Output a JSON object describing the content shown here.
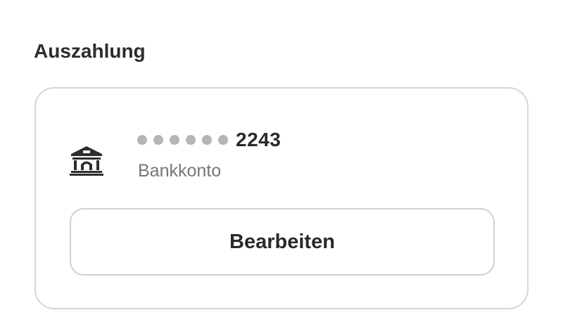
{
  "payout": {
    "title": "Auszahlung",
    "account": {
      "icon": "bank-icon",
      "masked_digit_count": 6,
      "last4": "2243",
      "type_label": "Bankkonto"
    },
    "edit_label": "Bearbeiten"
  },
  "colors": {
    "text_primary": "#2a2a2a",
    "text_secondary": "#767676",
    "border": "#d6d6d6",
    "mask_dot": "#b5b5b5"
  }
}
